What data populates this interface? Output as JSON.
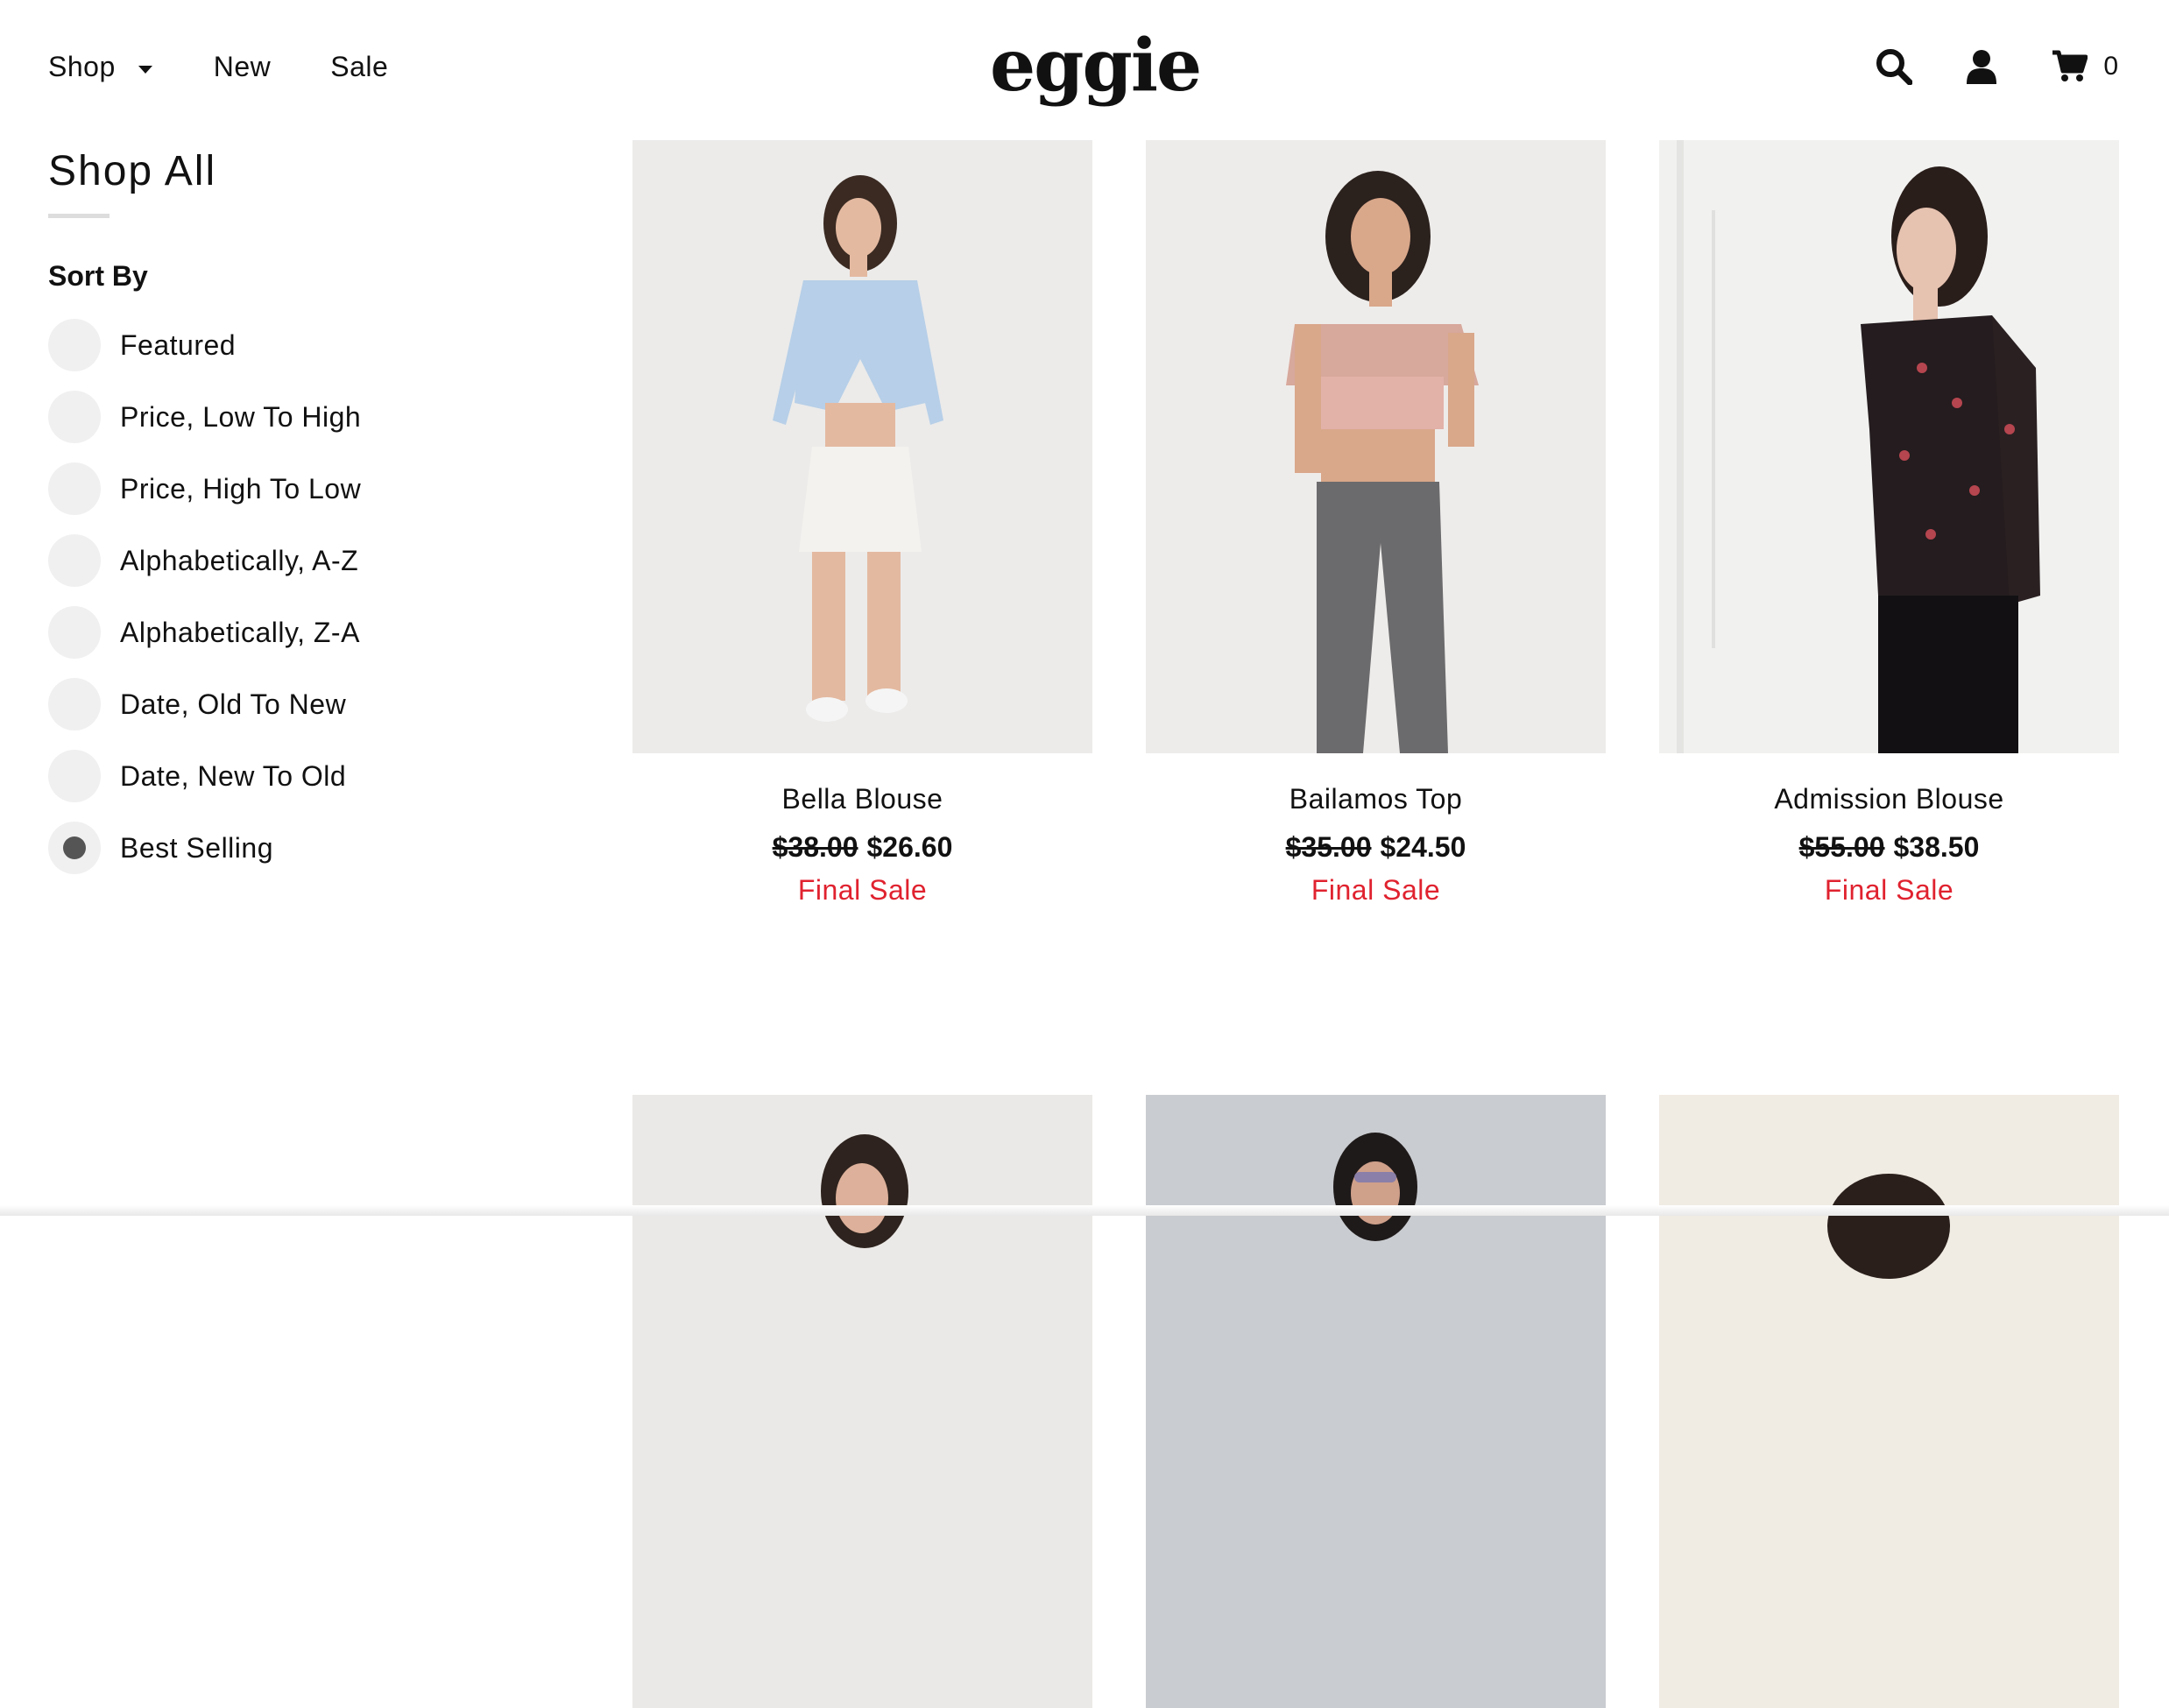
{
  "nav": {
    "shop_label": "Shop",
    "new_label": "New",
    "sale_label": "Sale"
  },
  "brand": {
    "logo_text": "eggie"
  },
  "header_icons": {
    "search": "search-icon",
    "account": "user-icon",
    "cart": "cart-icon",
    "cart_count": "0"
  },
  "sidebar": {
    "title": "Shop All",
    "sort_heading": "Sort By",
    "options": [
      {
        "label": "Featured",
        "selected": false
      },
      {
        "label": "Price, Low To High",
        "selected": false
      },
      {
        "label": "Price, High To Low",
        "selected": false
      },
      {
        "label": "Alphabetically, A-Z",
        "selected": false
      },
      {
        "label": "Alphabetically, Z-A",
        "selected": false
      },
      {
        "label": "Date, Old To New",
        "selected": false
      },
      {
        "label": "Date, New To Old",
        "selected": false
      },
      {
        "label": "Best Selling",
        "selected": true
      }
    ]
  },
  "products": [
    {
      "name": "Bella Blouse",
      "old_price": "$38.00",
      "price": "$26.60",
      "tag": "Final Sale"
    },
    {
      "name": "Bailamos Top",
      "old_price": "$35.00",
      "price": "$24.50",
      "tag": "Final Sale"
    },
    {
      "name": "Admission Blouse",
      "old_price": "$55.00",
      "price": "$38.50",
      "tag": "Final Sale"
    }
  ],
  "colors": {
    "accent_sale": "#e0222f",
    "text": "#111111",
    "radio_bg": "#f0f0f0",
    "radio_dot": "#555555"
  }
}
